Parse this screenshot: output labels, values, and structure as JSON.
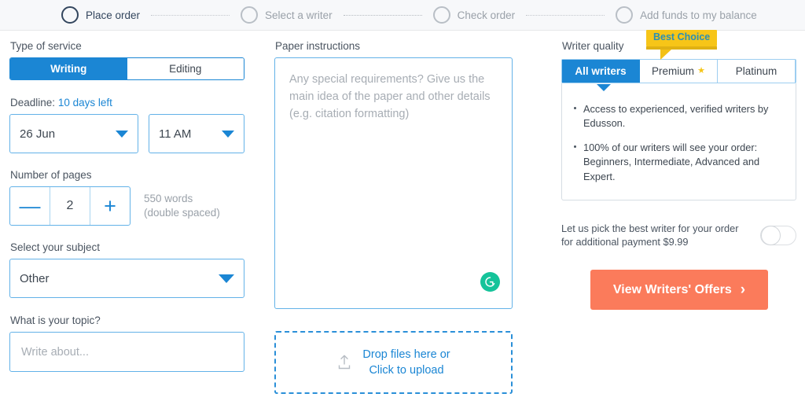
{
  "stepper": {
    "steps": [
      {
        "label": "Place order",
        "active": true
      },
      {
        "label": "Select a writer",
        "active": false
      },
      {
        "label": "Check order",
        "active": false
      },
      {
        "label": "Add funds to my balance",
        "active": false
      }
    ]
  },
  "left": {
    "service": {
      "label": "Type of service",
      "options": [
        "Writing",
        "Editing"
      ],
      "selected": "Writing"
    },
    "deadline": {
      "label_prefix": "Deadline:",
      "label_value": "10 days left",
      "date_value": "26 Jun",
      "time_value": "11 AM"
    },
    "pages": {
      "label": "Number of pages",
      "minus": "—",
      "value": "2",
      "plus": "+",
      "words_line1": "550 words",
      "words_line2": "(double spaced)"
    },
    "subject": {
      "label": "Select your subject",
      "value": "Other"
    },
    "topic": {
      "label": "What is your topic?",
      "value": "",
      "placeholder": "Write about..."
    }
  },
  "middle": {
    "instructions": {
      "label": "Paper instructions",
      "value": "",
      "placeholder": "Any special requirements? Give us the main idea of the paper and other details (e.g. citation formatting)"
    },
    "grammarly_letter": "G",
    "dropzone": {
      "line1": "Drop files here or",
      "line2": "Click to upload"
    }
  },
  "right": {
    "writer_quality_label": "Writer quality",
    "best_choice_badge": "Best Choice",
    "tabs": [
      {
        "label": "All writers",
        "star": false,
        "active": true
      },
      {
        "label": "Premium",
        "star": true,
        "active": false
      },
      {
        "label": "Platinum",
        "star": false,
        "active": false
      }
    ],
    "bullets": [
      "Access to experienced, verified writers by Edusson.",
      "100% of our writers will see your order: Beginners, Intermediate, Advanced and Expert."
    ],
    "pick_writer": {
      "line1": "Let us pick the best writer for your order",
      "line2": "for additional payment $9.99",
      "toggle_on": false
    },
    "cta": {
      "label": "View Writers' Offers",
      "chevron": "›"
    }
  },
  "colors": {
    "primary_blue": "#1b86d4",
    "border_blue": "#63b2e8",
    "cta_orange": "#fb7b5b",
    "badge_yellow": "#f7c518",
    "grammarly_green": "#15c39a",
    "muted_text": "#9aa1a9"
  }
}
